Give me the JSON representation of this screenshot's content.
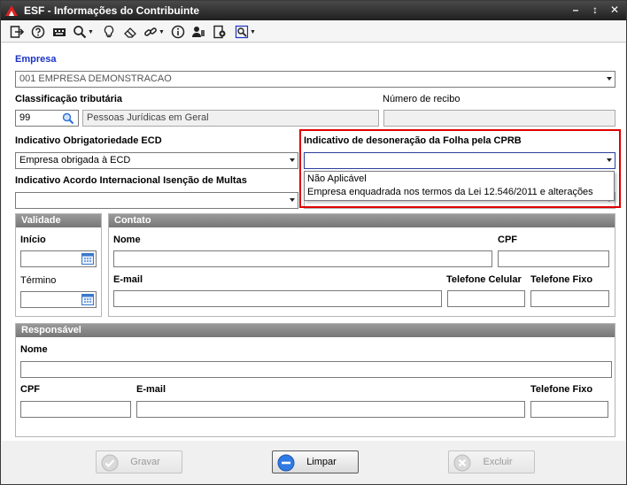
{
  "window": {
    "title": "ESF - Informações do Contribuinte",
    "minimize_glyph": "–",
    "restore_glyph": "↕",
    "close_glyph": "✕"
  },
  "toolbar": {
    "icons": [
      "exit-icon",
      "help-icon",
      "keyboard-icon",
      "zoom-icon",
      "lightbulb-icon",
      "eraser-icon",
      "link-icon",
      "info-icon",
      "users-icon",
      "export-icon",
      "tools-icon"
    ]
  },
  "empresa": {
    "label": "Empresa",
    "value": "001 EMPRESA DEMONSTRACAO"
  },
  "classificacao": {
    "label": "Classificação tributária",
    "code": "99",
    "description": "Pessoas Jurídicas em Geral"
  },
  "recibo": {
    "label": "Número de recibo",
    "value": ""
  },
  "ecd": {
    "label": "Indicativo Obrigatoriedade ECD",
    "value": "Empresa obrigada à ECD"
  },
  "cprb": {
    "label": "Indicativo de desoneração da  Folha pela CPRB",
    "value": "",
    "options": [
      "Não Aplicável",
      "Empresa enquadrada nos termos da Lei 12.546/2011 e alterações"
    ]
  },
  "acordo": {
    "label": "Indicativo Acordo Internacional Isenção de Multas",
    "value": ""
  },
  "validade": {
    "title": "Validade",
    "inicio_label": "Início",
    "inicio_value": "",
    "termino_label": "Término",
    "termino_value": ""
  },
  "contato": {
    "title": "Contato",
    "nome_label": "Nome",
    "cpf_label": "CPF",
    "email_label": "E-mail",
    "celular_label": "Telefone Celular",
    "fixo_label": "Telefone Fixo"
  },
  "responsavel": {
    "title": "Responsável",
    "nome_label": "Nome",
    "cpf_label": "CPF",
    "email_label": "E-mail",
    "fixo_label": "Telefone Fixo"
  },
  "buttons": {
    "gravar": "Gravar",
    "limpar": "Limpar",
    "excluir": "Excluir"
  },
  "colors": {
    "accent_blue": "#1b33c6",
    "highlight_red": "#e00000"
  }
}
